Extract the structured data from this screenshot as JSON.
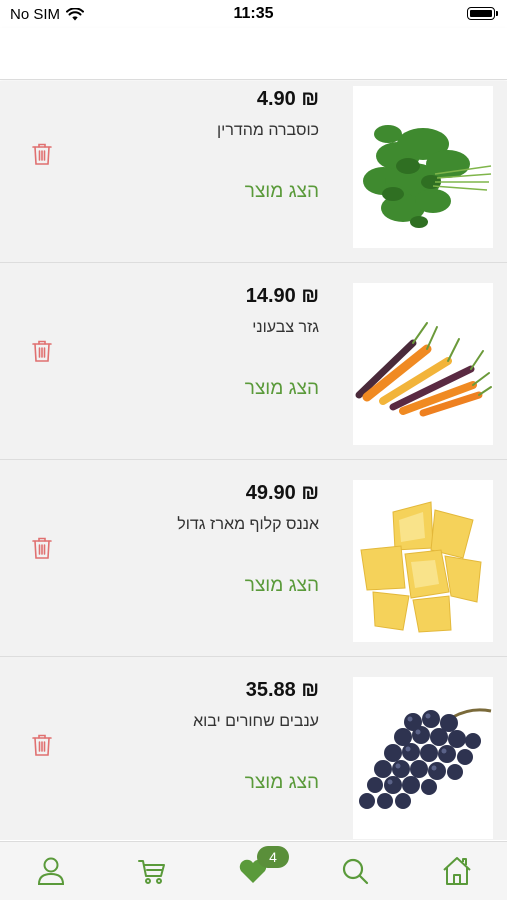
{
  "status_bar": {
    "carrier": "No SIM",
    "time": "11:35"
  },
  "colors": {
    "accent_green": "#5a9a3a",
    "trash_red": "#e07070",
    "badge_green": "#5a8f3a"
  },
  "items": [
    {
      "price": "₪ 4.90",
      "name": "כוסברה מהדרין",
      "action_label": "הצג מוצר",
      "image_icon": "coriander-icon"
    },
    {
      "price": "₪ 14.90",
      "name": "גזר צבעוני",
      "action_label": "הצג מוצר",
      "image_icon": "carrots-icon"
    },
    {
      "price": "₪ 49.90",
      "name": "אננס קלוף מארז גדול",
      "action_label": "הצג מוצר",
      "image_icon": "pineapple-icon"
    },
    {
      "price": "₪ 35.88",
      "name": "ענבים  שחורים יבוא",
      "action_label": "הצג מוצר",
      "image_icon": "grapes-icon"
    }
  ],
  "tab_bar": {
    "favorites_count": "4"
  }
}
